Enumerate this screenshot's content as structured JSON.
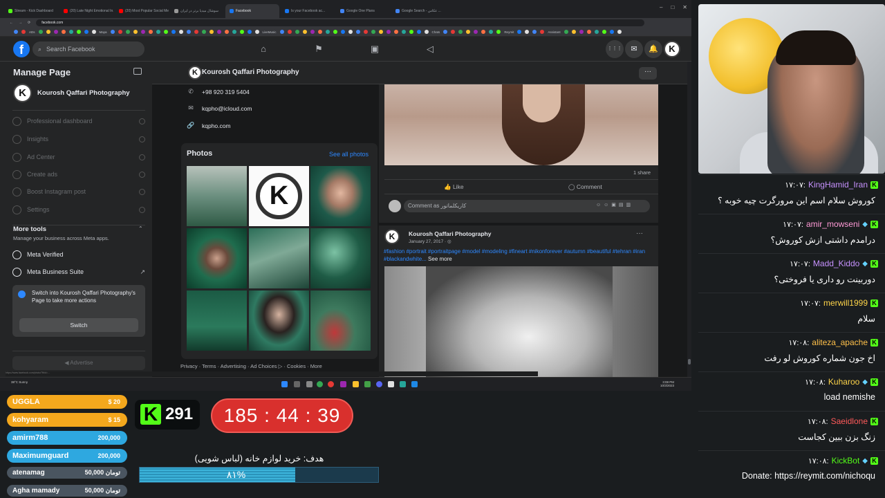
{
  "browser": {
    "tabs": [
      {
        "label": "Stream - Kick Dashboard",
        "color": "#53fc18"
      },
      {
        "label": "(20) Late Night Emotional In...",
        "color": "#ff0000"
      },
      {
        "label": "(20) Most Popular Social Me...",
        "color": "#ff0000"
      },
      {
        "label": "سوشال میدیا برتر در ایران",
        "color": "#999999"
      },
      {
        "label": "Facebook",
        "color": "#1877f2"
      },
      {
        "label": "Is your Facebook ac...",
        "color": "#1877f2"
      },
      {
        "label": "Google One Plans",
        "color": "#4285f4"
      },
      {
        "label": "Google Search - عکاس ...",
        "color": "#4285f4"
      }
    ],
    "url": "facebook.com",
    "window_controls": [
      "–",
      "□",
      "✕"
    ],
    "bookmarks": [
      "ADs",
      "Maya",
      "LiveMusic",
      "Chats",
      "Reymit",
      "Assistant"
    ]
  },
  "fb": {
    "search_placeholder": "Search Facebook",
    "logo": "f",
    "nav_icons": [
      "home-icon",
      "flag-icon",
      "pages-icon",
      "megaphone-icon"
    ],
    "nav_glyphs": [
      "⌂",
      "⚑",
      "▣",
      "◁"
    ],
    "right_icons": [
      "menu-grid-icon",
      "messenger-icon",
      "bell-icon",
      "profile-avatar"
    ],
    "right_glyphs": [
      "⋮⋮⋮",
      "✉",
      "🔔",
      "K"
    ]
  },
  "left": {
    "title": "Manage Page",
    "page_name": "Kourosh Qaffari Photography",
    "items": [
      {
        "label": "Professional dashboard"
      },
      {
        "label": "Insights"
      },
      {
        "label": "Ad Center"
      },
      {
        "label": "Create ads"
      },
      {
        "label": "Boost Instagram post"
      },
      {
        "label": "Settings"
      }
    ],
    "more_tools_title": "More tools",
    "more_tools_sub": "Manage your business across Meta apps.",
    "meta_verified": "Meta Verified",
    "meta_business_suite": "Meta Business Suite",
    "switch_text": "Switch into Kourosh Qaffari Photography's Page to take more actions",
    "switch_button": "Switch",
    "advertise": "Advertise"
  },
  "main": {
    "page_name": "Kourosh Qaffari Photography",
    "more": "···",
    "phone": "+98 920 319 5404",
    "email": "kqpho@icloud.com",
    "website": "kqpho.com",
    "photos_title": "Photos",
    "see_all": "See all photos",
    "footer": "Privacy · Terms · Advertising · Ad Choices ▷ · Cookies · More",
    "post1": {
      "shares": "1 share",
      "like": "Like",
      "comment": "Comment",
      "comment_placeholder": "Comment as کاریکلماتور"
    },
    "post2": {
      "name": "Kourosh Qaffari Photography",
      "date": "January 27, 2017 · ",
      "tags": "#fashion #portrait #portraitpage #model #modeling #fineart #nikonforever #autumn #beautiful #tehran #iran #blackandwhite...",
      "see_more": " See more"
    }
  },
  "taskbar": {
    "weather": "38°C Sunny",
    "time": "3:08 PM",
    "date": "10/3/2023"
  },
  "chat": [
    {
      "user": "KingHamid_Iran",
      "user_color": "#c792ff",
      "time": "۱۷:۰۷",
      "text": "کوروش سلام اسم این مرورگرت چیه خوبه ؟",
      "diamond": false
    },
    {
      "user": "amir_mowseni",
      "user_color": "#ff9ad6",
      "time": "۱۷:۰۷",
      "text": "درامدم داشتی ازش کوروش؟",
      "diamond": true
    },
    {
      "user": "Madd_Kiddo",
      "user_color": "#c792ff",
      "time": "۱۷:۰۷",
      "text": "دوربینت رو داری یا فروختی؟",
      "diamond": true
    },
    {
      "user": "merwill1999",
      "user_color": "#ffd54a",
      "time": "۱۷:۰۷",
      "text": "سلام",
      "diamond": false
    },
    {
      "user": "aliteza_apache",
      "user_color": "#ffc04a",
      "time": "۱۷:۰۸",
      "text": "اخ جون شماره کوروش لو رفت",
      "diamond": false
    },
    {
      "user": "Kuharoo",
      "user_color": "#ffd54a",
      "time": "۱۷:۰۸",
      "text": "load nemishe",
      "diamond": true
    },
    {
      "user": "Saeidlone",
      "user_color": "#ff5a5a",
      "time": "۱۷:۰۸",
      "text": "زنگ بزن ببین کجاست",
      "diamond": false
    },
    {
      "user": "KickBot",
      "user_color": "#53fc18",
      "time": "۱۷:۰۸",
      "text": "Donate: https://reymit.com/nichoqu",
      "diamond": true
    }
  ],
  "donations": [
    {
      "name": "UGGLA",
      "amount": "$ 20",
      "color": "#f4a81d"
    },
    {
      "name": "kohyaram",
      "amount": "$ 15",
      "color": "#f4a81d"
    },
    {
      "name": "amirm788",
      "amount": "200,000",
      "color": "#2ea8e0"
    },
    {
      "name": "Maximumguard",
      "amount": "200,000",
      "color": "#2ea8e0"
    },
    {
      "name": "atenamag",
      "amount": "50,000 تومان",
      "color": "#4a5560"
    },
    {
      "name": "Agha mamady",
      "amount": "50,000 تومان",
      "color": "#4a5560"
    }
  ],
  "kick": {
    "logo": "K",
    "viewers": "291"
  },
  "timer": "185 : 44 : 39",
  "goal": {
    "title": "هدف: خرید لوازم خانه (لباس شویی)",
    "label": "۸۱%",
    "fraction": 0.81
  }
}
